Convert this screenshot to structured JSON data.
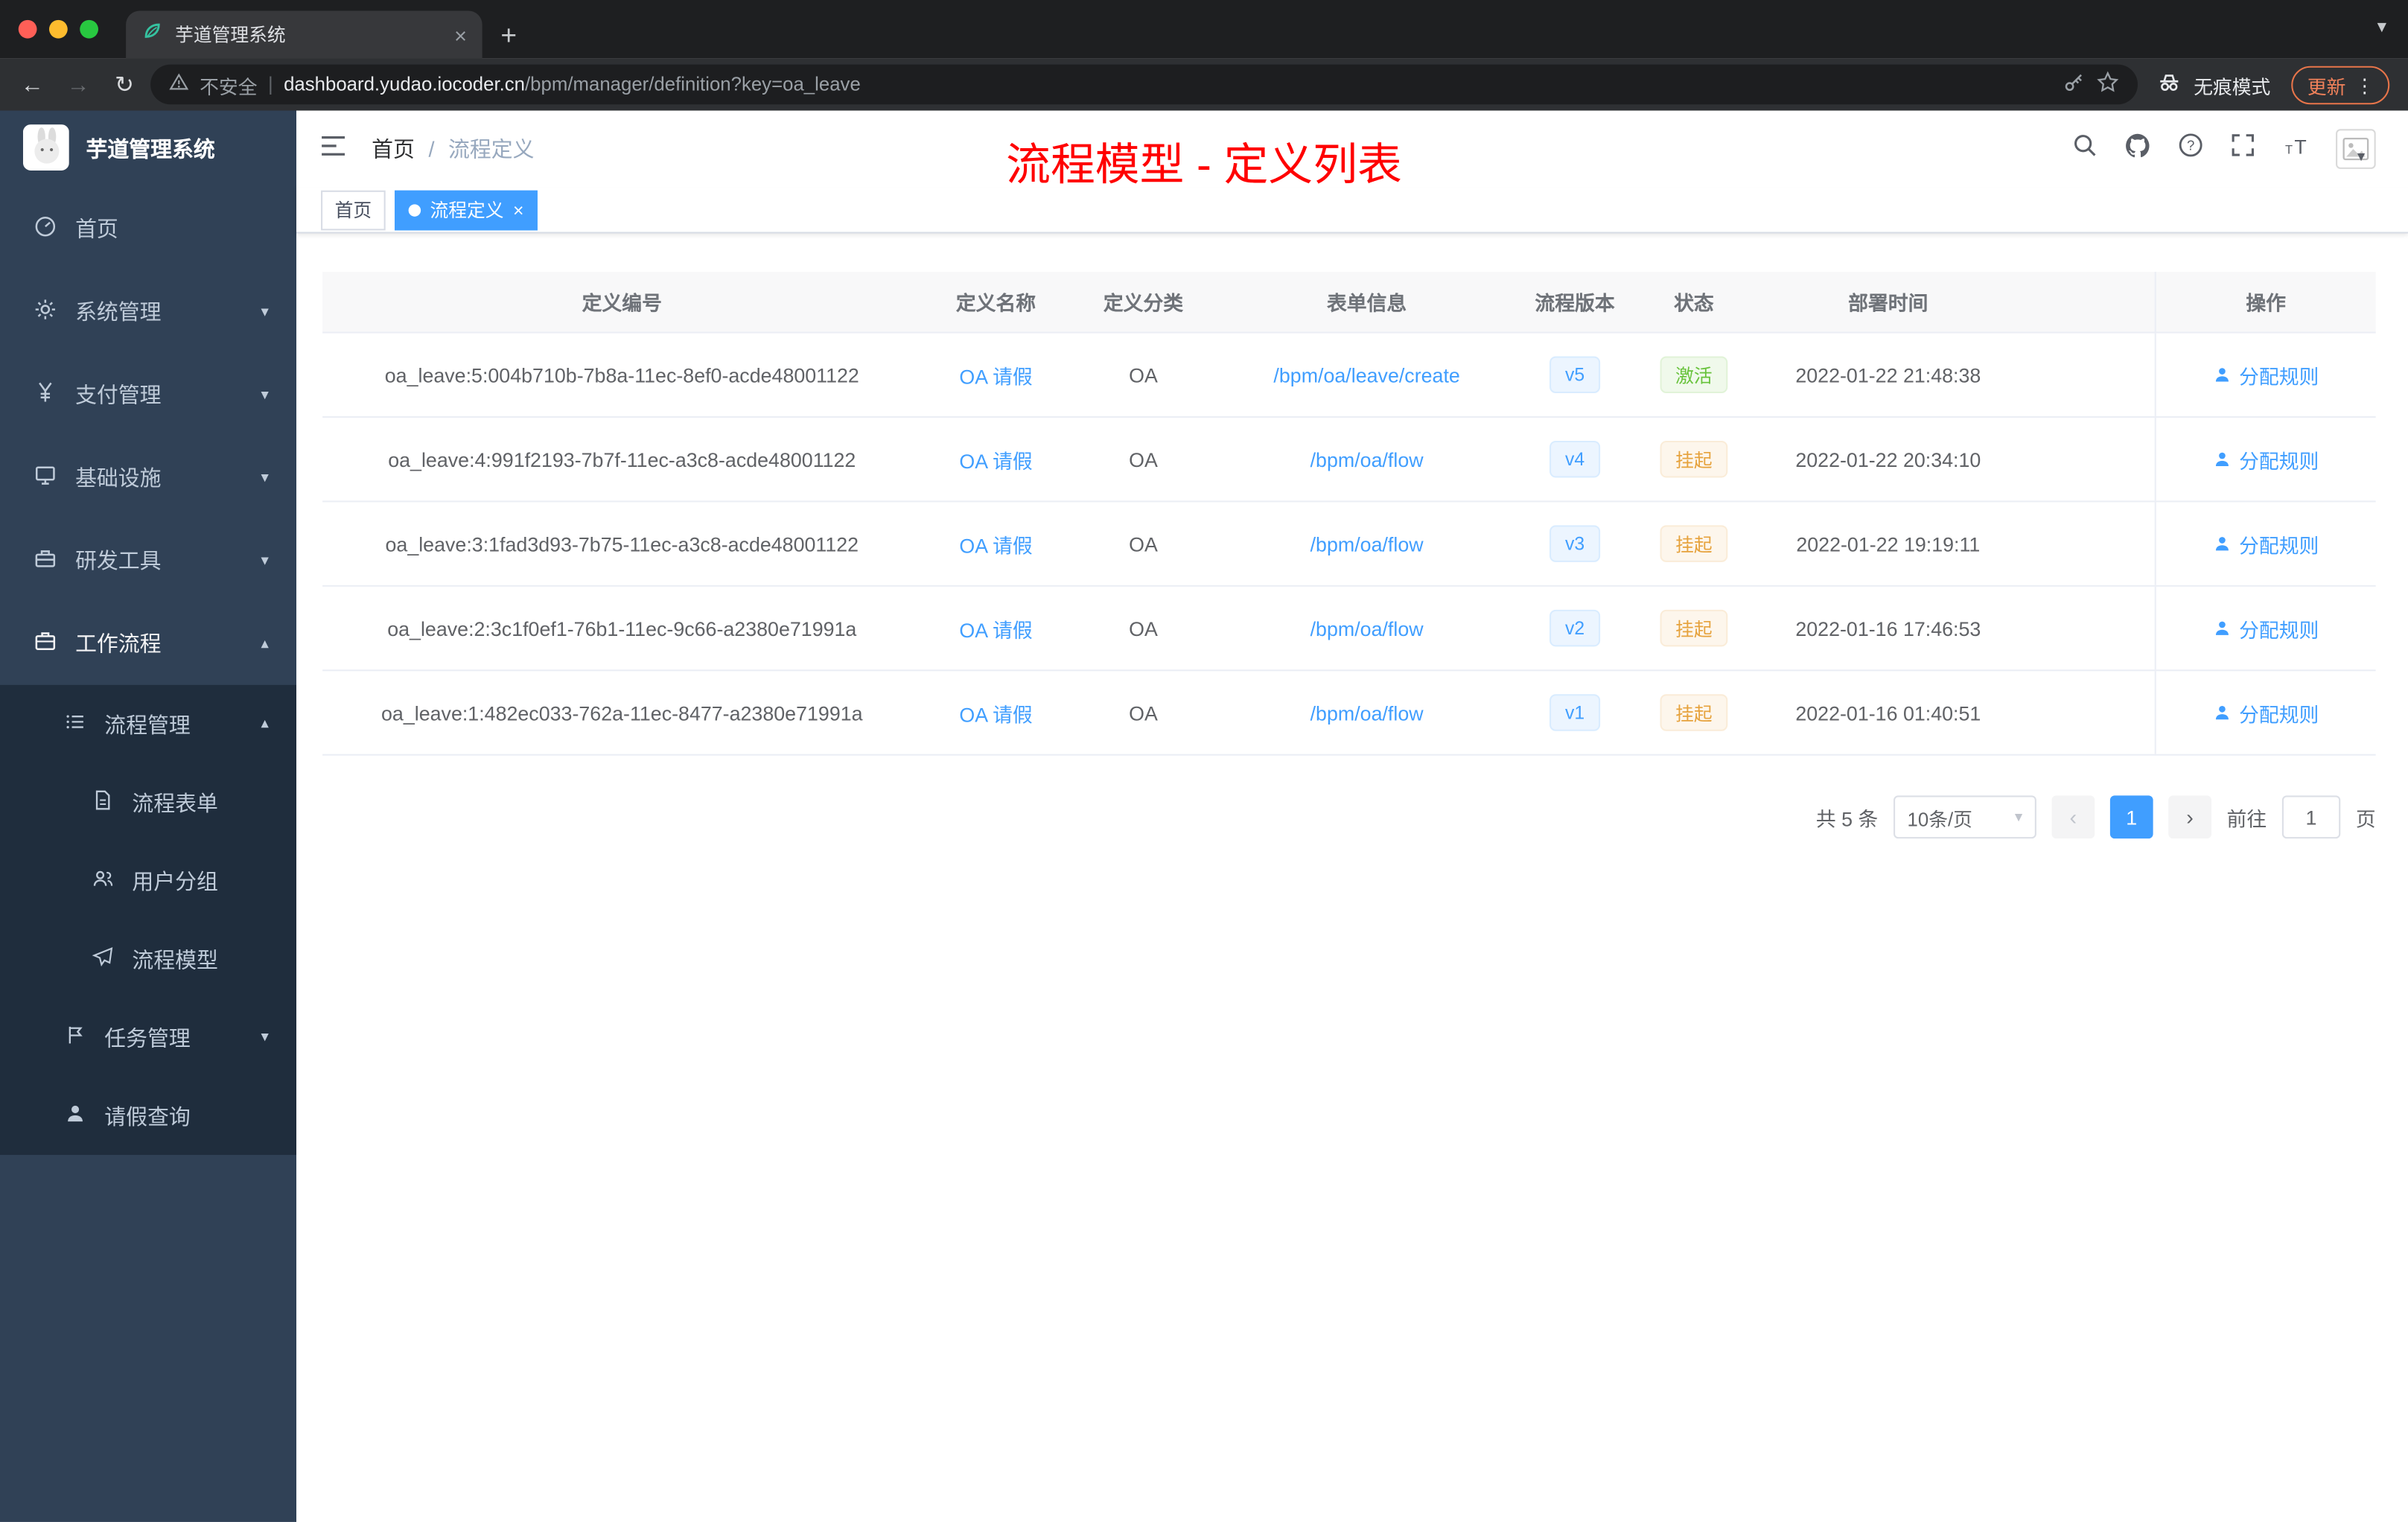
{
  "browser": {
    "tab_title": "芋道管理系统",
    "close_tab": "×",
    "new_tab": "+",
    "tab_search": "▾",
    "back_icon": "←",
    "forward_icon": "→",
    "reload_icon": "↻",
    "security_label": "不安全",
    "url_sep": "|",
    "url_domain": "dashboard.yudao.iocoder.cn",
    "url_path": "/bpm/manager/definition?key=oa_leave",
    "incognito_label": "无痕模式",
    "update_label": "更新",
    "menu_dots": "⋮"
  },
  "sidebar": {
    "logo_title": "芋道管理系统",
    "chevron_down": "▾",
    "chevron_up": "▴",
    "items": [
      {
        "label": "首页"
      },
      {
        "label": "系统管理"
      },
      {
        "label": "支付管理"
      },
      {
        "label": "基础设施"
      },
      {
        "label": "研发工具"
      },
      {
        "label": "工作流程"
      },
      {
        "label": "流程管理"
      },
      {
        "label": "流程表单"
      },
      {
        "label": "用户分组"
      },
      {
        "label": "流程模型"
      },
      {
        "label": "任务管理"
      },
      {
        "label": "请假查询"
      }
    ]
  },
  "header": {
    "breadcrumb_home": "首页",
    "breadcrumb_sep": "/",
    "breadcrumb_current": "流程定义",
    "annotation": "流程模型 - 定义列表",
    "avatar_caret": "▾"
  },
  "tags": {
    "home": "首页",
    "active": "流程定义",
    "active_close": "×"
  },
  "table": {
    "columns": [
      "定义编号",
      "定义名称",
      "定义分类",
      "表单信息",
      "流程版本",
      "状态",
      "部署时间",
      "操作"
    ],
    "rows": [
      {
        "id": "oa_leave:5:004b710b-7b8a-11ec-8ef0-acde48001122",
        "name": "OA 请假",
        "category": "OA",
        "form": "/bpm/oa/leave/create",
        "version": "v5",
        "status": "激活",
        "time": "2022-01-22 21:48:38",
        "action": "分配规则"
      },
      {
        "id": "oa_leave:4:991f2193-7b7f-11ec-a3c8-acde48001122",
        "name": "OA 请假",
        "category": "OA",
        "form": "/bpm/oa/flow",
        "version": "v4",
        "status": "挂起",
        "time": "2022-01-22 20:34:10",
        "action": "分配规则"
      },
      {
        "id": "oa_leave:3:1fad3d93-7b75-11ec-a3c8-acde48001122",
        "name": "OA 请假",
        "category": "OA",
        "form": "/bpm/oa/flow",
        "version": "v3",
        "status": "挂起",
        "time": "2022-01-22 19:19:11",
        "action": "分配规则"
      },
      {
        "id": "oa_leave:2:3c1f0ef1-76b1-11ec-9c66-a2380e71991a",
        "name": "OA 请假",
        "category": "OA",
        "form": "/bpm/oa/flow",
        "version": "v2",
        "status": "挂起",
        "time": "2022-01-16 17:46:53",
        "action": "分配规则"
      },
      {
        "id": "oa_leave:1:482ec033-762a-11ec-8477-a2380e71991a",
        "name": "OA 请假",
        "category": "OA",
        "form": "/bpm/oa/flow",
        "version": "v1",
        "status": "挂起",
        "time": "2022-01-16 01:40:51",
        "action": "分配规则"
      }
    ]
  },
  "pagination": {
    "total": "共 5 条",
    "page_size": "10条/页",
    "select_caret": "▾",
    "prev": "‹",
    "current_page": "1",
    "next": "›",
    "goto_label": "前往",
    "goto_value": "1",
    "unit_label": "页"
  },
  "colors": {
    "accent_blue": "#409eff",
    "sidebar_bg": "#304156",
    "submenu_bg": "#1f2d3d",
    "status_active_green": "#67c23a",
    "status_suspended_orange": "#e6a23c",
    "annotation_red": "#ff0000"
  }
}
